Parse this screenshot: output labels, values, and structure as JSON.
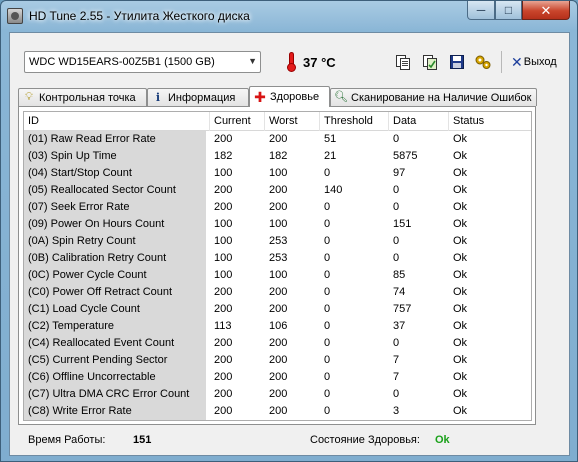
{
  "window": {
    "title": "HD Tune 2.55 - Утилита Жесткого диска",
    "minimize_glyph": "─",
    "maximize_glyph": "□",
    "close_glyph": "✕"
  },
  "toolbar": {
    "drive": "WDC WD15EARS-00Z5B1 (1500 GB)",
    "temperature": "37 °C",
    "exit_label": "Выход",
    "icons": [
      "copy-icon",
      "copy-all-icon",
      "save-icon",
      "options-icon",
      "exit-icon"
    ]
  },
  "tabs": [
    {
      "label": "Контрольная точка",
      "icon": "lightbulb-icon"
    },
    {
      "label": "Информация",
      "icon": "info-icon"
    },
    {
      "label": "Здоровье",
      "icon": "health-cross-icon",
      "active": true
    },
    {
      "label": "Сканирование на Наличие Ошибок",
      "icon": "magnifier-icon"
    }
  ],
  "table": {
    "columns": [
      "ID",
      "Current",
      "Worst",
      "Threshold",
      "Data",
      "Status"
    ],
    "rows": [
      [
        "(01) Raw Read Error Rate",
        "200",
        "200",
        "51",
        "0",
        "Ok"
      ],
      [
        "(03) Spin Up Time",
        "182",
        "182",
        "21",
        "5875",
        "Ok"
      ],
      [
        "(04) Start/Stop Count",
        "100",
        "100",
        "0",
        "97",
        "Ok"
      ],
      [
        "(05) Reallocated Sector Count",
        "200",
        "200",
        "140",
        "0",
        "Ok"
      ],
      [
        "(07) Seek Error Rate",
        "200",
        "200",
        "0",
        "0",
        "Ok"
      ],
      [
        "(09) Power On Hours Count",
        "100",
        "100",
        "0",
        "151",
        "Ok"
      ],
      [
        "(0A) Spin Retry Count",
        "100",
        "253",
        "0",
        "0",
        "Ok"
      ],
      [
        "(0B) Calibration Retry Count",
        "100",
        "253",
        "0",
        "0",
        "Ok"
      ],
      [
        "(0C) Power Cycle Count",
        "100",
        "100",
        "0",
        "85",
        "Ok"
      ],
      [
        "(C0) Power Off Retract Count",
        "200",
        "200",
        "0",
        "74",
        "Ok"
      ],
      [
        "(C1) Load Cycle Count",
        "200",
        "200",
        "0",
        "757",
        "Ok"
      ],
      [
        "(C2) Temperature",
        "113",
        "106",
        "0",
        "37",
        "Ok"
      ],
      [
        "(C4) Reallocated Event Count",
        "200",
        "200",
        "0",
        "0",
        "Ok"
      ],
      [
        "(C5) Current Pending Sector",
        "200",
        "200",
        "0",
        "7",
        "Ok"
      ],
      [
        "(C6) Offline Uncorrectable",
        "200",
        "200",
        "0",
        "7",
        "Ok"
      ],
      [
        "(C7) Ultra DMA CRC Error Count",
        "200",
        "200",
        "0",
        "0",
        "Ok"
      ],
      [
        "(C8) Write Error Rate",
        "200",
        "200",
        "0",
        "3",
        "Ok"
      ]
    ]
  },
  "footer": {
    "uptime_label": "Время Работы:",
    "uptime_value": "151",
    "health_label": "Состояние Здоровья:",
    "health_value": "Ok"
  },
  "colors": {
    "health_ok": "#1aa11a",
    "id_column_bg": "#d9d9d9",
    "temperature_icon": "#e31b1b"
  }
}
